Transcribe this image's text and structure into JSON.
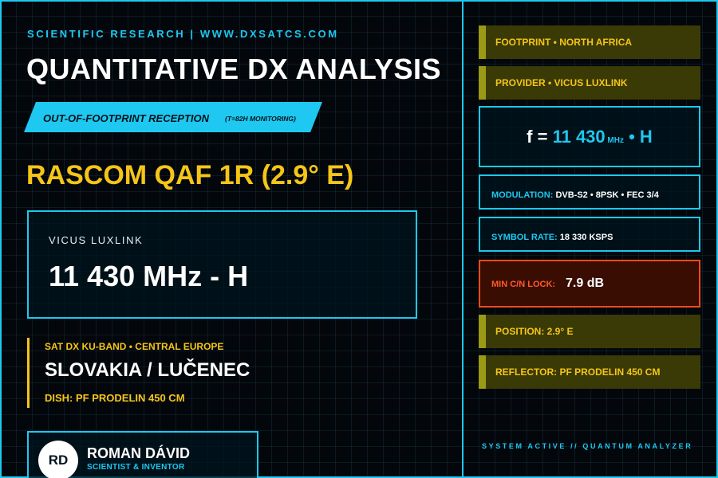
{
  "header": {
    "kicker": "SCIENTIFIC RESEARCH | WWW.DXSATCS.COM",
    "title": "QUANTITATIVE DX ANALYSIS",
    "banner_main": "OUT-OF-FOOTPRINT RECEPTION",
    "banner_sub": "(T=82H MONITORING)"
  },
  "satellite": {
    "name": "RASCOM QAF 1R (2.9° E)"
  },
  "frequency_card": {
    "provider": "VICUS LUXLINK",
    "value": "11 430 MHz - H"
  },
  "location": {
    "tag": "SAT DX KU-BAND • CENTRAL EUROPE",
    "city": "SLOVAKIA / LUČENEC",
    "dish": "DISH: PF PRODELIN 450 CM"
  },
  "author": {
    "initials": "RD",
    "name": "ROMAN DÁVID",
    "role": "SCIENTIST & INVENTOR"
  },
  "right_panel": {
    "footprint": "FOOTPRINT • NORTH AFRICA",
    "provider": "PROVIDER • VICUS LUXLINK",
    "freq_eq": "f = ",
    "freq_num": "11 430",
    "freq_unit": " MHz",
    "freq_pol": " • H",
    "modulation_label": "MODULATION: ",
    "modulation_value": "DVB-S2 • 8PSK • FEC 3/4",
    "symbol_label": "SYMBOL RATE: ",
    "symbol_value": "18 330 KSPS",
    "cn_label": "MIN C/N LOCK:",
    "cn_value": "7.9 dB",
    "position": "POSITION: 2.9° E",
    "reflector": "REFLECTOR: PF PRODELIN 450 CM"
  },
  "status": "SYSTEM ACTIVE // QUANTUM ANALYZER",
  "colors": {
    "accent_cyan": "#1ec8f0",
    "accent_yellow": "#f5c518",
    "alert_red": "#ff4a1c",
    "background": "#03070b"
  }
}
